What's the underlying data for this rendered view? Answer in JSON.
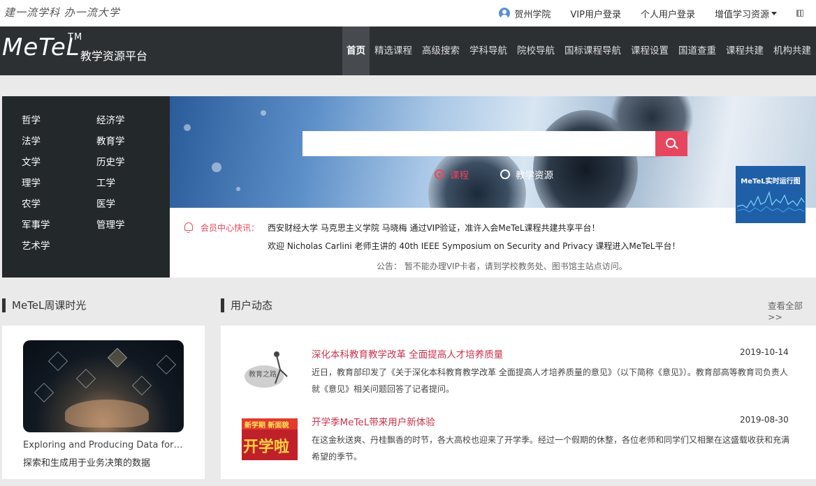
{
  "top": {
    "slogan": "建一流学科  办一流大学",
    "institution": "贺州学院",
    "vip_login": "VIP用户登录",
    "personal_login": "个人用户登录",
    "resources": "增值学习资源"
  },
  "brand": {
    "logo": "MeTeL",
    "tm": "TM",
    "subtitle": "教学资源平台"
  },
  "nav": {
    "items": [
      {
        "label": "首页",
        "active": true
      },
      {
        "label": "精选课程"
      },
      {
        "label": "高级搜索"
      },
      {
        "label": "学科导航"
      },
      {
        "label": "院校导航"
      },
      {
        "label": "国标课程导航"
      },
      {
        "label": "课程设置"
      },
      {
        "label": "国道查重"
      },
      {
        "label": "课程共建"
      },
      {
        "label": "机构共建"
      }
    ]
  },
  "categories": [
    "哲学",
    "经济学",
    "法学",
    "教育学",
    "文学",
    "历史学",
    "理学",
    "工学",
    "农学",
    "医学",
    "军事学",
    "管理学",
    "艺术学"
  ],
  "search": {
    "placeholder": "",
    "options": [
      "课程",
      "教学资源"
    ],
    "selected": "课程"
  },
  "news": {
    "label": "会员中心快讯：",
    "lines": [
      "西安财经大学 马克思主义学院 马晓梅 通过VIP验证，准许入会MeTeL课程共建共享平台！",
      "欢迎 Nicholas Carlini 老师主讲的 40th IEEE Symposium on Security and Privacy 课程进入MeTeL平台！"
    ],
    "notice": "公告：  暂不能办理VIP卡者，请到学校教务处、图书馆主站点访问。"
  },
  "monitor": {
    "title": "MeTeL实时运行图"
  },
  "weekly": {
    "heading": "MeTeL周课时光",
    "title": "Exploring and Producing Data for Business Decision Making",
    "subtitle": "探索和生成用于业务决策的数据"
  },
  "activity": {
    "heading": "用户动态",
    "see_all": "查看全部>>",
    "items": [
      {
        "title": "深化本科教育教学改革 全面提高人才培养质量",
        "date": "2019-10-14",
        "desc": "近日，教育部印发了《关于深化本科教育教学改革 全面提高人才培养质量的意见》（以下简称《意见》）。教育部高等教育司负责人就《意见》相关问题回答了记者提问。"
      },
      {
        "title": "开学季MeTeL带来用户新体验",
        "date": "2019-08-30",
        "desc": "在这金秋送爽、丹桂飘香的时节，各大高校也迎来了开学季。经过一个假期的休整，各位老师和同学们又相聚在这盛载收获和充满希望的季节。"
      }
    ]
  },
  "colors": {
    "accent": "#e7475e",
    "nav_bg": "#2d3033",
    "category_bg": "#23282b"
  }
}
